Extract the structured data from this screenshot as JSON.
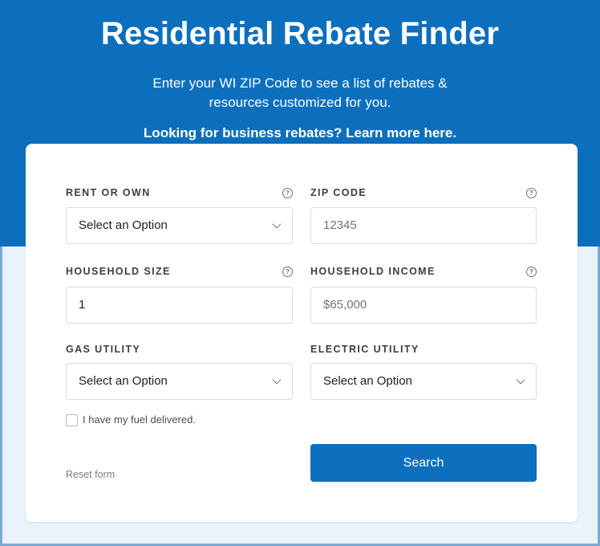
{
  "header": {
    "title": "Residential Rebate Finder",
    "subtitle_line1": "Enter your WI ZIP Code to see a list of rebates &",
    "subtitle_line2": "resources customized for you.",
    "business_link": "Looking for business rebates? Learn more here."
  },
  "form": {
    "rent_or_own": {
      "label": "RENT OR OWN",
      "value": "Select an Option"
    },
    "zip_code": {
      "label": "ZIP CODE",
      "placeholder": "12345"
    },
    "household_size": {
      "label": "HOUSEHOLD SIZE",
      "value": "1"
    },
    "household_income": {
      "label": "HOUSEHOLD INCOME",
      "placeholder": "$65,000"
    },
    "gas_utility": {
      "label": "GAS UTILITY",
      "value": "Select an Option"
    },
    "electric_utility": {
      "label": "ELECTRIC UTILITY",
      "value": "Select an Option"
    },
    "fuel_delivered": {
      "label": "I have my fuel delivered.",
      "checked": false
    },
    "reset_label": "Reset form",
    "search_label": "Search",
    "help_glyph": "?"
  },
  "colors": {
    "brand_blue": "#0b6fbe",
    "page_background": "#eaf2fb"
  }
}
